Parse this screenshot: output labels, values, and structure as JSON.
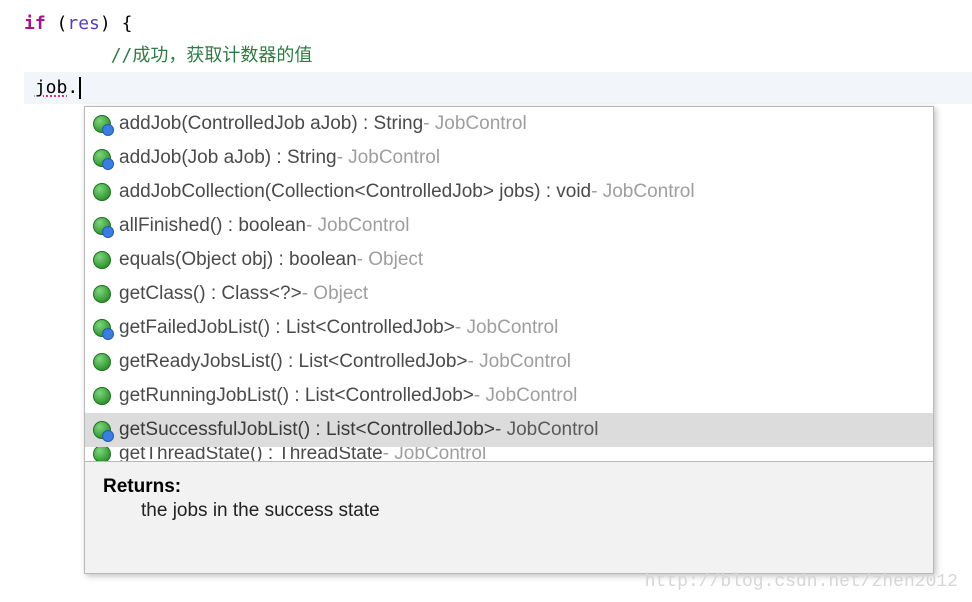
{
  "code": {
    "line1_if": "if",
    "line1_open_paren": " (",
    "line1_ident": "res",
    "line1_close_paren": ") ",
    "line1_brace": "{",
    "line2_indent": "        ",
    "line2_comment": "//成功，获取计数器的值",
    "line3_indent": " ",
    "line3_job": "job",
    "line3_dot": "."
  },
  "suggestions": [
    {
      "icon": "inherited",
      "sig": "addJob(ControlledJob aJob) : String",
      "cls": " - JobControl"
    },
    {
      "icon": "inherited",
      "sig": "addJob(Job aJob) : String",
      "cls": " - JobControl"
    },
    {
      "icon": "public",
      "sig": "addJobCollection(Collection<ControlledJob> jobs) : void",
      "cls": " - JobControl"
    },
    {
      "icon": "inherited",
      "sig": "allFinished() : boolean",
      "cls": " - JobControl"
    },
    {
      "icon": "public",
      "sig": "equals(Object obj) : boolean",
      "cls": " - Object"
    },
    {
      "icon": "public",
      "sig": "getClass() : Class<?>",
      "cls": " - Object"
    },
    {
      "icon": "inherited",
      "sig": "getFailedJobList() : List<ControlledJob>",
      "cls": " - JobControl"
    },
    {
      "icon": "public",
      "sig": "getReadyJobsList() : List<ControlledJob>",
      "cls": " - JobControl"
    },
    {
      "icon": "public",
      "sig": "getRunningJobList() : List<ControlledJob>",
      "cls": " - JobControl"
    },
    {
      "icon": "inherited",
      "sig": "getSuccessfulJobList() : List<ControlledJob>",
      "cls": " - JobControl",
      "selected": true
    },
    {
      "icon": "public",
      "sig": "getThreadState() : ThreadState",
      "cls": " - JobControl",
      "partial": true
    }
  ],
  "doc": {
    "heading": "Returns:",
    "text": "the jobs in the success state"
  },
  "watermark": "http://blog.csdn.net/zhen2012"
}
